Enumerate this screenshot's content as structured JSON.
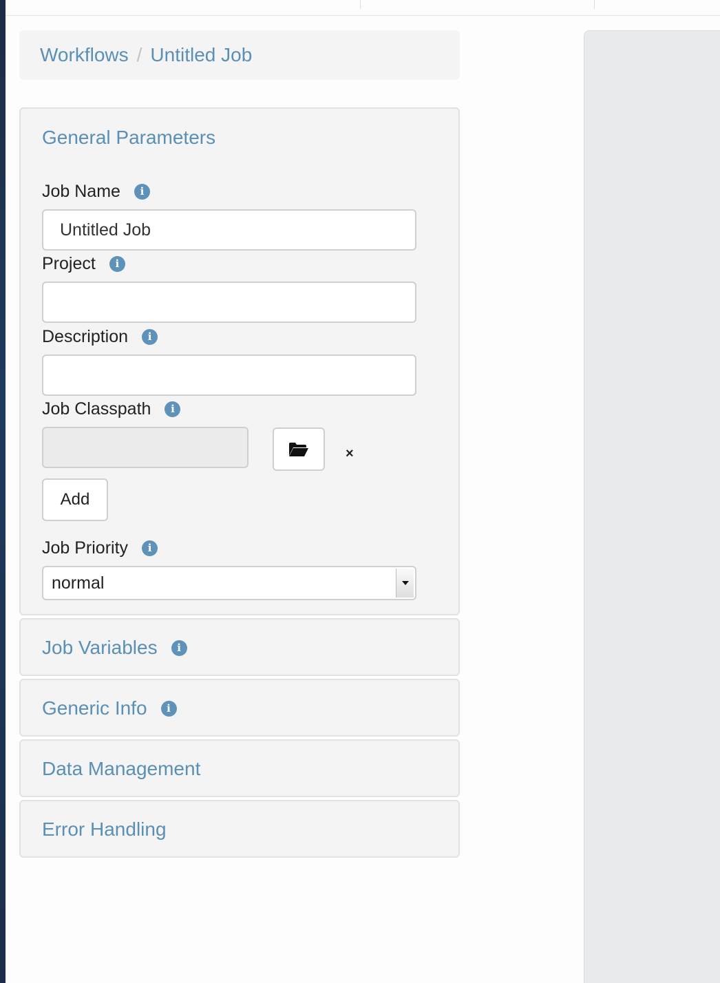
{
  "breadcrumb": {
    "items": [
      "Workflows",
      "Untitled Job"
    ],
    "divider": "/"
  },
  "general": {
    "title": "General Parameters",
    "job_name": {
      "label": "Job Name",
      "value": "Untitled Job",
      "placeholder": ""
    },
    "project": {
      "label": "Project",
      "value": "",
      "placeholder": ""
    },
    "description": {
      "label": "Description",
      "value": "",
      "placeholder": ""
    },
    "job_classpath": {
      "label": "Job Classpath",
      "value": "",
      "remove_label": "×",
      "add_label": "Add"
    },
    "job_priority": {
      "label": "Job Priority",
      "selected": "normal"
    }
  },
  "sections": [
    {
      "title": "Job Variables",
      "info": true
    },
    {
      "title": "Generic Info",
      "info": true
    },
    {
      "title": "Data Management",
      "info": false
    },
    {
      "title": "Error Handling",
      "info": false
    }
  ],
  "icons": {
    "info": "info-icon",
    "browse": "folder-open-icon",
    "remove": "close-icon",
    "dropdown": "chevron-down-icon"
  },
  "colors": {
    "link": "#5a8fb6",
    "info_icon": "#5f92b8",
    "panel_bg": "#f4f4f4",
    "right_panel_bg": "#e8ebee"
  }
}
